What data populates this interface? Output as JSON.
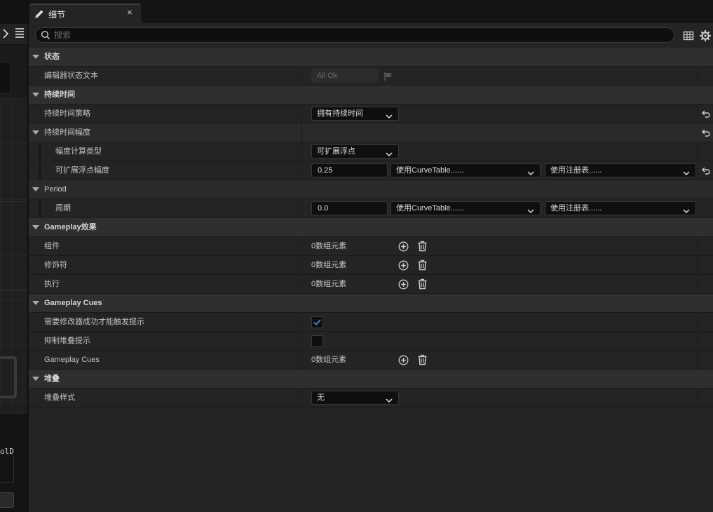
{
  "tab": {
    "title": "细节",
    "close_glyph": "×"
  },
  "search": {
    "placeholder": "搜索"
  },
  "left_strip": {
    "text_fragment": "olD"
  },
  "sections": {
    "status": {
      "label": "状态",
      "editor_status_text": {
        "label": "编辑器状态文本",
        "value": "All Ok"
      }
    },
    "duration": {
      "label": "持续时间",
      "policy": {
        "label": "持续时间策略",
        "value": "拥有持续时间"
      },
      "magnitude": {
        "label": "持续时间幅度",
        "calc_type": {
          "label": "幅度计算类型",
          "value": "可扩展浮点"
        },
        "scalable_float": {
          "label": "可扩展浮点幅度",
          "value": "0.25",
          "curve_table": "使用CurveTable......",
          "registry": "使用注册表......"
        }
      }
    },
    "period": {
      "label": "Period",
      "period": {
        "label": "周期",
        "value": "0.0",
        "curve_table": "使用CurveTable......",
        "registry": "使用注册表......"
      }
    },
    "gameplay_effects": {
      "label": "Gameplay效果",
      "components": {
        "label": "组件",
        "value": "0数组元素"
      },
      "modifiers": {
        "label": "修饰符",
        "value": "0数组元素"
      },
      "executions": {
        "label": "执行",
        "value": "0数组元素"
      }
    },
    "gameplay_cues": {
      "label": "Gameplay Cues",
      "require_modifier_success": {
        "label": "需要修改器成功才能触发提示",
        "checked": true
      },
      "suppress_stacking": {
        "label": "抑制堆叠提示",
        "checked": false
      },
      "cues": {
        "label": "Gameplay Cues",
        "value": "0数组元素"
      }
    },
    "stacking": {
      "label": "堆叠",
      "stacking_type": {
        "label": "堆叠样式",
        "value": "无"
      }
    }
  },
  "colors": {
    "accent_check": "#3a8fe0",
    "panel_bg": "#242424",
    "category_bg": "#2f2f2f"
  }
}
